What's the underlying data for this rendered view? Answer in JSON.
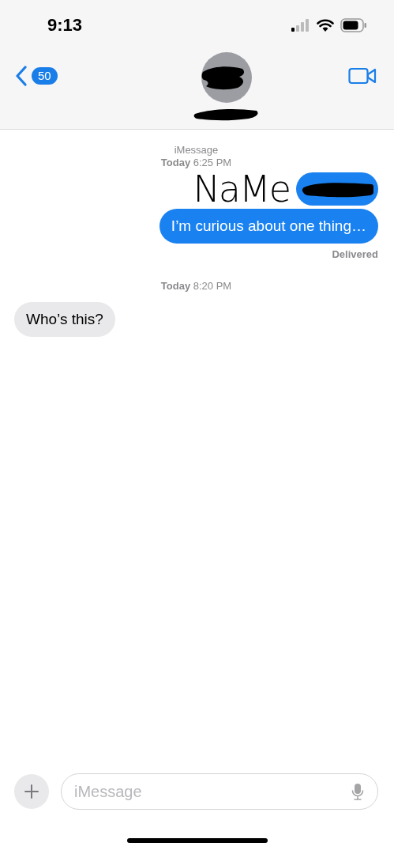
{
  "status_bar": {
    "time": "9:13"
  },
  "header": {
    "back_count": "50"
  },
  "messages": [
    {
      "kind": "service",
      "text": "iMessage"
    },
    {
      "kind": "timestamp",
      "text": "**Today** 6:25 PM"
    },
    {
      "kind": "redacted",
      "annotation": "NaMe"
    },
    {
      "kind": "outgoing",
      "text": "I’m curious about one thing…"
    },
    {
      "kind": "status",
      "text": "Delivered"
    },
    {
      "kind": "timestamp",
      "text": "**Today** 8:20 PM"
    },
    {
      "kind": "incoming",
      "text": "Who’s this?"
    }
  ],
  "composer": {
    "placeholder": "iMessage"
  }
}
